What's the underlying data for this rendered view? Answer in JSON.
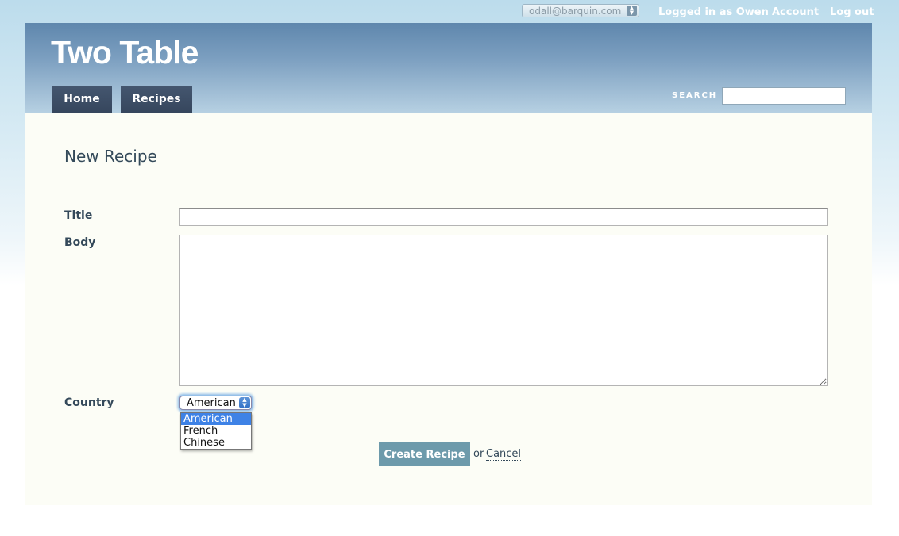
{
  "topbar": {
    "account_email": "odall@barquin.com",
    "logged_in_text": "Logged in as Owen",
    "account_link": "Account",
    "logout_link": "Log out"
  },
  "header": {
    "logo": "Two Table",
    "tabs": [
      {
        "label": "Home"
      },
      {
        "label": "Recipes"
      }
    ],
    "search_label": "SEARCH"
  },
  "form": {
    "page_title": "New Recipe",
    "title_label": "Title",
    "title_value": "",
    "body_label": "Body",
    "body_value": "",
    "country_label": "Country",
    "country_selected": "American",
    "country_options": [
      "American",
      "French",
      "Chinese"
    ],
    "submit_label": "Create Recipe",
    "or_text": "or",
    "cancel_label": "Cancel"
  },
  "colors": {
    "header_dark": "#5f87ad",
    "tab_bg": "#3e4e66",
    "button_bg": "#6d9aab",
    "dropdown_highlight": "#3e82e6",
    "main_bg": "#fcfdf6"
  }
}
